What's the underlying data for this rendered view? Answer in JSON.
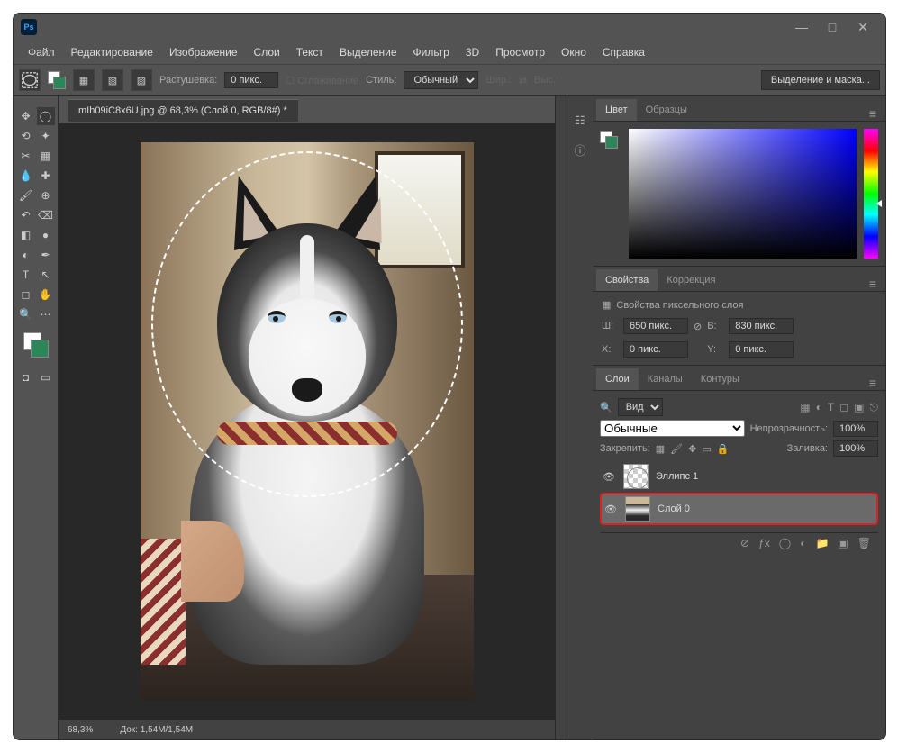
{
  "menu": {
    "file": "Файл",
    "edit": "Редактирование",
    "image": "Изображение",
    "layer": "Слои",
    "text": "Текст",
    "select": "Выделение",
    "filter": "Фильтр",
    "threeD": "3D",
    "view": "Просмотр",
    "window": "Окно",
    "help": "Справка"
  },
  "options": {
    "feather_label": "Растушевка:",
    "feather_value": "0 пикс.",
    "antialias": "Сглаживание",
    "style_label": "Стиль:",
    "style_value": "Обычный",
    "width_label": "Шир.:",
    "height_label": "Выс.:",
    "mask_button": "Выделение и маска..."
  },
  "doc": {
    "tab": "mIh09iC8x6U.jpg @ 68,3% (Слой 0, RGB/8#) *",
    "zoom": "68,3%",
    "docsize": "Док: 1,54M/1,54M"
  },
  "panels": {
    "color": {
      "tab_color": "Цвет",
      "tab_swatches": "Образцы"
    },
    "props": {
      "tab_props": "Свойства",
      "tab_adjust": "Коррекция",
      "subtitle": "Свойства пиксельного слоя",
      "w_label": "Ш:",
      "w_value": "650 пикс.",
      "h_label": "В:",
      "h_value": "830 пикс.",
      "x_label": "X:",
      "x_value": "0 пикс.",
      "y_label": "Y:",
      "y_value": "0 пикс."
    },
    "layers": {
      "tab_layers": "Слои",
      "tab_channels": "Каналы",
      "tab_paths": "Контуры",
      "kind": "Вид",
      "blend": "Обычные",
      "opacity_label": "Непрозрачность:",
      "opacity_value": "100%",
      "lock_label": "Закрепить:",
      "fill_label": "Заливка:",
      "fill_value": "100%",
      "layer1": "Эллипс 1",
      "layer0": "Слой 0"
    }
  }
}
